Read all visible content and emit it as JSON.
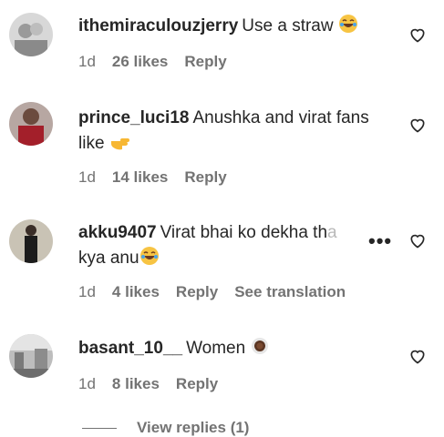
{
  "comments": [
    {
      "username": "ithemiraculouzjerry",
      "text": "Use a straw",
      "emoji": "laughing-face",
      "time": "1d",
      "likes": "26 likes",
      "reply": "Reply"
    },
    {
      "username": "prince_luci18",
      "text": "Anushka and virat fans",
      "text2": "like",
      "emoji": "pointing-hand",
      "time": "1d",
      "likes": "14 likes",
      "reply": "Reply"
    },
    {
      "username": "akku9407",
      "text": "Virat bhai ko dekha th",
      "text_faded": "a",
      "text2": "kya anu",
      "emoji": "laughing-face",
      "time": "1d",
      "likes": "4 likes",
      "reply": "Reply",
      "translation": "See translation"
    },
    {
      "username": "basant_10__",
      "text": "Women",
      "emoji": "coffee-cup",
      "time": "1d",
      "likes": "8 likes",
      "reply": "Reply"
    }
  ],
  "more_label": "•••",
  "view_replies": "View replies (1)",
  "colors": {
    "text": "#262626",
    "muted": "#737373"
  }
}
